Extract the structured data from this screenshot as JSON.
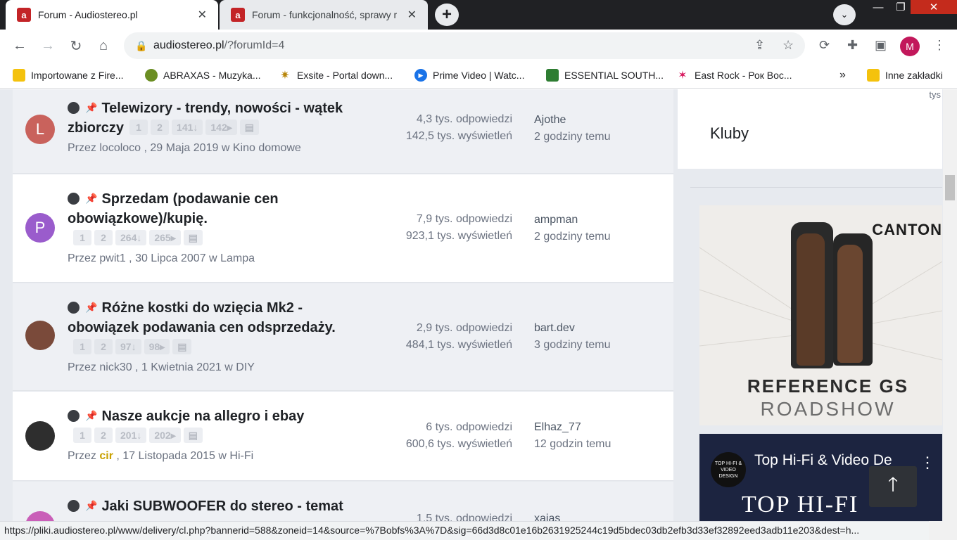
{
  "tabs": [
    {
      "title": "Forum - Audiostereo.pl",
      "favicon": "a"
    },
    {
      "title": "Forum - funkcjonalność, sprawy r",
      "favicon": "a"
    }
  ],
  "address": {
    "domain": "audiostereo.pl",
    "path": "/?forumId=4"
  },
  "profile_initial": "M",
  "bookmarks": [
    {
      "label": "Importowane z Fire...",
      "icon": "folder-icon"
    },
    {
      "label": "ABRAXAS - Muzyka...",
      "icon": "abraxas-icon"
    },
    {
      "label": "Exsite - Portal down...",
      "icon": "exsite-icon"
    },
    {
      "label": "Prime Video | Watc...",
      "icon": "prime-video-icon"
    },
    {
      "label": "ESSENTIAL SOUTH...",
      "icon": "essential-icon"
    },
    {
      "label": "East Rock - Рок Вос...",
      "icon": "eastrock-icon"
    }
  ],
  "bookmarks_more": "»",
  "bookmarks_other": "Inne zakładki",
  "topics": [
    {
      "title": "Telewizory - trendy, nowości - wątek zbiorczy",
      "avatar_letter": "L",
      "avatar_color": "#c9625c",
      "pages": [
        "1",
        "2",
        "141↓",
        "142▸",
        "▤"
      ],
      "by_prefix": "Przez",
      "author": "locoloco",
      "date": "29 Maja 2019",
      "in_word": "w",
      "forum": "Kino domowe",
      "replies": "4,3 tys. odpowiedzi",
      "views": "142,5 tys. wyświetleń",
      "last_user": "Ajothe",
      "last_time": "2 godziny temu"
    },
    {
      "title": "Sprzedam (podawanie cen obowiązkowe)/kupię.",
      "avatar_letter": "P",
      "avatar_color": "#9a5ccc",
      "pages": [
        "1",
        "2",
        "264↓",
        "265▸",
        "▤"
      ],
      "by_prefix": "Przez",
      "author": "pwit1",
      "date": "30 Lipca 2007",
      "in_word": "w",
      "forum": "Lampa",
      "replies": "7,9 tys. odpowiedzi",
      "views": "923,1 tys. wyświetleń",
      "last_user": "ampman",
      "last_time": "2 godziny temu"
    },
    {
      "title": "Różne kostki do wzięcia Mk2 - obowiązek podawania cen odsprzedaży.",
      "avatar_letter": "",
      "avatar_color": "#7a4a3a",
      "pages": [
        "1",
        "2",
        "97↓",
        "98▸",
        "▤"
      ],
      "by_prefix": "Przez",
      "author": "nick30",
      "date": "1 Kwietnia 2021",
      "in_word": "w",
      "forum": "DIY",
      "replies": "2,9 tys. odpowiedzi",
      "views": "484,1 tys. wyświetleń",
      "last_user": "bart.dev",
      "last_time": "3 godziny temu"
    },
    {
      "title": "Nasze aukcje na allegro i ebay",
      "avatar_letter": "",
      "avatar_color": "#2e2e2e",
      "pages": [
        "1",
        "2",
        "201↓",
        "202▸",
        "▤"
      ],
      "by_prefix": "Przez",
      "author": "cir",
      "date": "17 Listopada 2015",
      "in_word": "w",
      "forum": "Hi-Fi",
      "replies": "6 tys. odpowiedzi",
      "views": "600,6 tys. wyświetleń",
      "last_user": "Elhaz_77",
      "last_time": "12 godzin temu"
    },
    {
      "title": "Jaki SUBWOOFER do stereo - temat",
      "avatar_letter": "",
      "avatar_color": "#c95fb8",
      "pages": [],
      "by_prefix": "",
      "author": "",
      "date": "",
      "in_word": "",
      "forum": "",
      "replies": "1,5 tys. odpowiedzi",
      "views": "",
      "last_user": "xajas",
      "last_time": ""
    }
  ],
  "sidebar": {
    "tys_fragment": "tys",
    "clubs_title": "Kluby",
    "ad": {
      "brand": "CANTON",
      "line1": "REFERENCE GS",
      "line2": "ROADSHOW"
    },
    "video": {
      "channel_logo": "TOP HI-FI & VIDEO DESIGN",
      "title": "Top Hi-Fi & Video De",
      "big_text": "TOP HI-FI"
    }
  },
  "status_url": "https://pliki.audiostereo.pl/www/delivery/cl.php?bannerid=588&zoneid=14&source=%7Bobfs%3A%7D&sig=66d3d8c01e16b2631925244c19d5bdec03db2efb3d33ef32892eed3adb11e203&dest=h...",
  "colors": {
    "accent": "#c32427",
    "pin": "#3f9b55",
    "page_bg": "#e7eaef"
  }
}
